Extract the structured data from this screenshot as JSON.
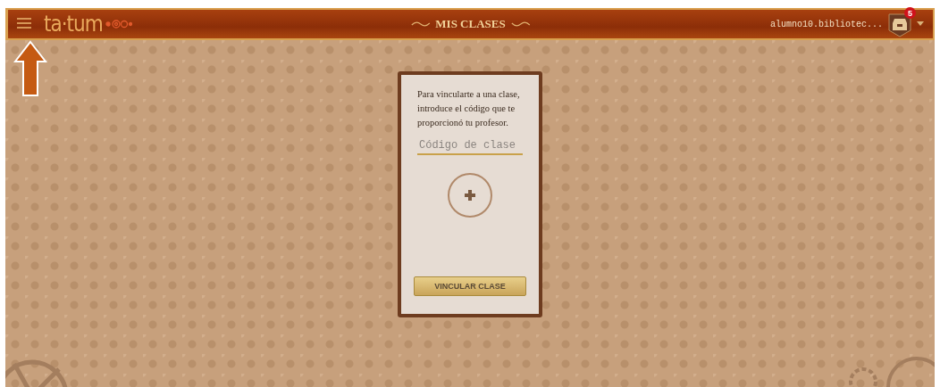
{
  "header": {
    "logo": "ta·tum",
    "title": "MIS CLASES",
    "user": "alumno10.bibliotec...",
    "notification_count": "5"
  },
  "card": {
    "instructions": "Para vincularte a una clase, introduce el código que te proporcionó tu profesor.",
    "code_field": {
      "placeholder": "Código de clase"
    },
    "submit": "VINCULAR CLASE"
  }
}
